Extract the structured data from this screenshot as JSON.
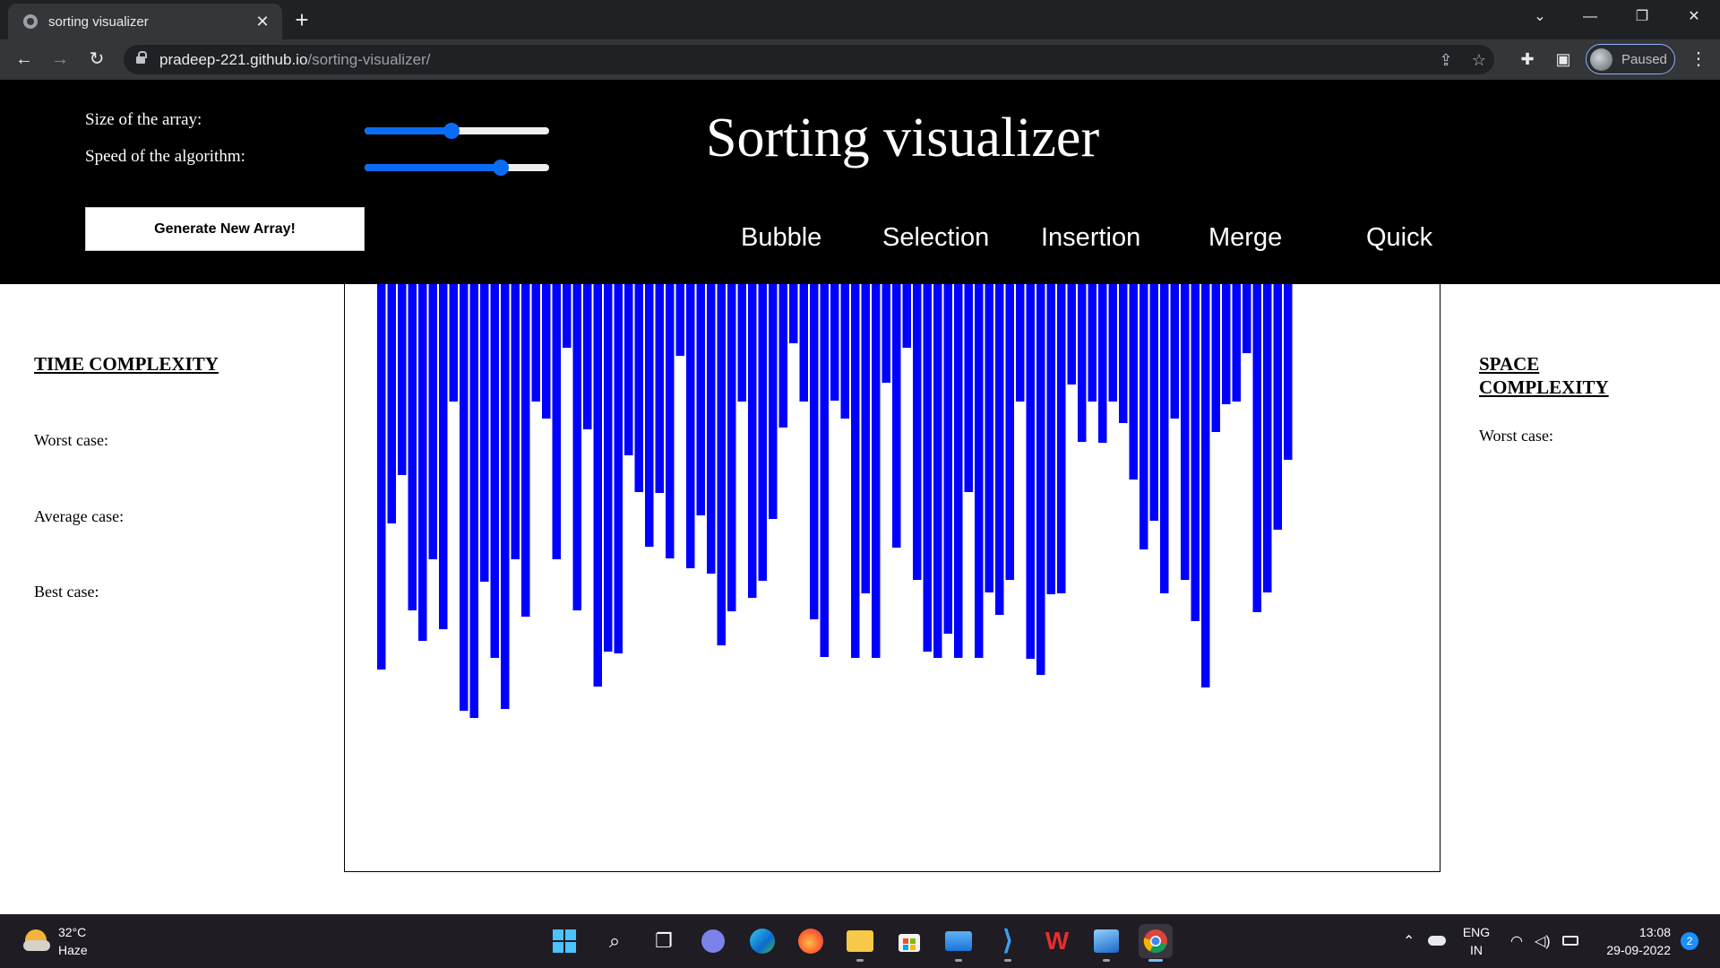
{
  "browser": {
    "tab_title": "sorting visualizer",
    "url_host": "pradeep-221.github.io",
    "url_path": "/sorting-visualizer/",
    "profile_status": "Paused",
    "icons": [
      "globe-icon",
      "close-icon",
      "plus-icon",
      "chevron-down-icon",
      "minimize-icon",
      "restore-icon",
      "close-window-icon",
      "back-icon",
      "forward-icon",
      "reload-icon",
      "lock-icon",
      "share-icon",
      "star-icon",
      "puzzle-icon",
      "sidepanel-icon",
      "avatar",
      "more-icon"
    ]
  },
  "header": {
    "size_label": "Size of the array:",
    "speed_label": "Speed of the algorithm:",
    "size_slider_value": 0.47,
    "speed_slider_value": 0.74,
    "generate_label": "Generate New Array!",
    "title": "Sorting visualizer",
    "algorithms": [
      "Bubble",
      "Selection",
      "Insertion",
      "Merge",
      "Quick"
    ]
  },
  "time_complexity": {
    "heading": "TIME COMPLEXITY",
    "worst_label": "Worst case:",
    "average_label": "Average case:",
    "best_label": "Best case:"
  },
  "space_complexity": {
    "heading_line1": "SPACE",
    "heading_line2": "COMPLEXITY",
    "worst_label": "Worst case:"
  },
  "array": {
    "bar_color": "#0000ff",
    "values": [
      430,
      267,
      213,
      364,
      398,
      307,
      385,
      131,
      476,
      484,
      332,
      417,
      474,
      307,
      371,
      131,
      150,
      307,
      71,
      364,
      162,
      449,
      410,
      412,
      191,
      232,
      293,
      233,
      306,
      80,
      317,
      258,
      323,
      403,
      365,
      131,
      350,
      331,
      262,
      160,
      66,
      131,
      374,
      416,
      130,
      150,
      417,
      345,
      417,
      110,
      294,
      71,
      330,
      410,
      417,
      390,
      417,
      232,
      417,
      344,
      369,
      330,
      131,
      418,
      436,
      346,
      345,
      112,
      176,
      131,
      177,
      131,
      155,
      218,
      296,
      264,
      345,
      150,
      330,
      376,
      450,
      165,
      134,
      131,
      77,
      366,
      344,
      274,
      196
    ]
  },
  "taskbar": {
    "temperature": "32°C",
    "condition": "Haze",
    "lang_line1": "ENG",
    "lang_line2": "IN",
    "time": "13:08",
    "date": "29-09-2022",
    "notification_count": "2",
    "icons": [
      "weather-icon",
      "start-icon",
      "search-icon",
      "task-view-icon",
      "chat-icon",
      "edge-icon",
      "firefox-icon",
      "file-explorer-icon",
      "store-icon",
      "mail-icon",
      "vscode-icon",
      "wps-icon",
      "photos-icon",
      "chrome-icon",
      "chevron-up-icon",
      "onedrive-icon",
      "wifi-icon",
      "volume-icon",
      "battery-icon"
    ]
  }
}
